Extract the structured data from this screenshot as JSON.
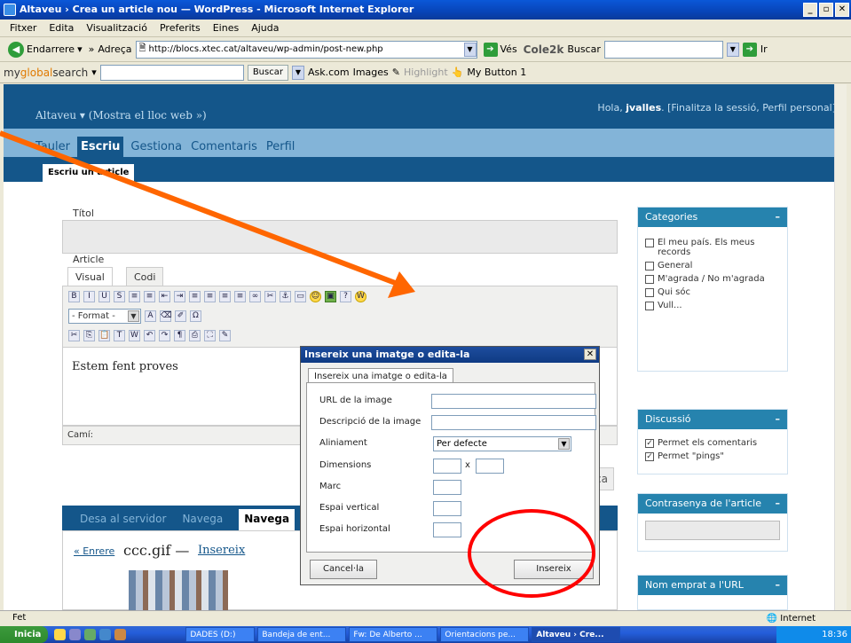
{
  "window": {
    "title": "Altaveu › Crea un article nou — WordPress - Microsoft Internet Explorer",
    "buttons": [
      "_",
      "▫",
      "✕"
    ]
  },
  "menu": [
    "Fitxer",
    "Edita",
    "Visualització",
    "Preferits",
    "Eines",
    "Ajuda"
  ],
  "toolbar": {
    "back_label": "Endarrere",
    "address_label": "Adreça",
    "address_value": "http://blocs.xtec.cat/altaveu/wp-admin/post-new.php",
    "go_label": "Vés",
    "cole_label": "Cole2k",
    "buscar_label": "Buscar",
    "ir_label": "Ir"
  },
  "searchbar": {
    "brand_prefix": "my",
    "brand_mid": "global",
    "brand_suffix": "search",
    "buscar_button": "Buscar",
    "askcom": "Ask.com",
    "images": "Images",
    "highlight": "Highlight",
    "mybutton": "My Button 1"
  },
  "wp": {
    "site_name": "Altaveu",
    "view_site": "(Mostra el lloc web »)",
    "greeting": "Hola,",
    "username": "jvalles",
    "user_links": ". [Finalitza la sessió, Perfil personal]",
    "menu": [
      "Tauler",
      "Escriu",
      "Gestiona",
      "Comentaris",
      "Perfil"
    ],
    "submenu_tab": "Escriu un article",
    "title_label": "Títol",
    "article_label": "Article",
    "tab_visual": "Visual",
    "tab_code": "Codi",
    "format_select": "- Format -",
    "editor_text": "Estem fent proves",
    "path_label": "Camí:",
    "upload_tabs": [
      "Desa al servidor",
      "Navega",
      "Navega"
    ],
    "prev_link": "« Enrere",
    "filename": "ccc.gif",
    "filename_dash": "—",
    "insert_link": "Insereix",
    "partial_button": "ca"
  },
  "sidebar": {
    "categories_title": "Categories",
    "categories": [
      "El meu país. Els meus records",
      "General",
      "M'agrada / No m'agrada",
      "Qui sóc",
      "Vull..."
    ],
    "discussion_title": "Discussió",
    "discussion_items": [
      "Permet els comentaris",
      "Permet \"pings\""
    ],
    "password_title": "Contrasenya de l'article",
    "slug_title": "Nom emprat a l'URL",
    "minimize": "–"
  },
  "dialog": {
    "title": "Insereix una imatge o edita-la",
    "tab": "Insereix una imatge o edita-la",
    "fields": {
      "url_label": "URL de la image",
      "desc_label": "Descripció de la image",
      "align_label": "Aliniament",
      "align_value": "Per defecte",
      "dimensions_label": "Dimensions",
      "dim_x": "x",
      "border_label": "Marc",
      "vspace_label": "Espai vertical",
      "hspace_label": "Espai horizontal"
    },
    "cancel": "Cancel·la",
    "insert": "Insereix"
  },
  "status": {
    "text": "Fet",
    "zone": "Internet"
  },
  "taskbar": {
    "start": "Inicia",
    "tasks": [
      "DADES (D:)",
      "Bandeja de ent...",
      "Fw: De Alberto ...",
      "Orientacions pe...",
      "Altaveu › Cre..."
    ],
    "clock": "18:36"
  },
  "colors": {
    "wp_dark_blue": "#14568a",
    "wp_light_blue": "#83b4d8",
    "sidebar_head": "#2683ae",
    "annotation_orange": "#ff6600",
    "annotation_red": "#ff0000"
  }
}
